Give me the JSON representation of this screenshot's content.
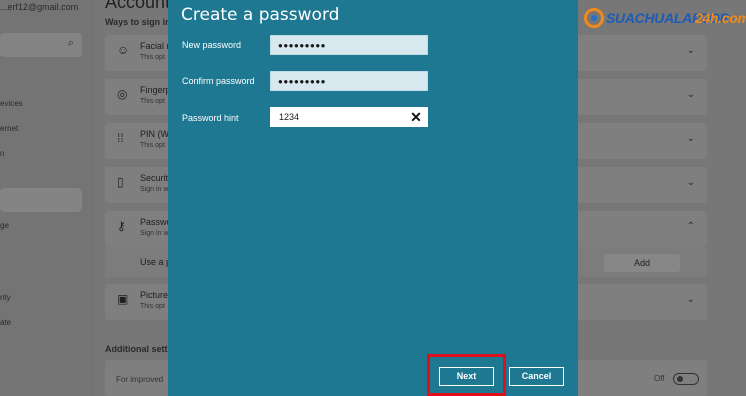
{
  "background": {
    "title": "Accounts",
    "email": "...erf12@gmail.com",
    "nav_items": [
      "evices",
      "ernet",
      "n",
      "ge",
      "rity",
      "ate"
    ],
    "section_ways": "Ways to sign in",
    "section_additional": "Additional settin",
    "cards": [
      {
        "title": "Facial r",
        "subtitle": "This opt",
        "icon": "face-icon"
      },
      {
        "title": "Fingerp",
        "subtitle": "This opt",
        "icon": "fingerprint-icon"
      },
      {
        "title": "PIN (W",
        "subtitle": "This opt",
        "icon": "keypad-icon"
      },
      {
        "title": "Security",
        "subtitle": "Sign in w",
        "icon": "security-key-icon"
      },
      {
        "title": "Passwo",
        "subtitle": "Sign in w",
        "icon": "key-icon"
      },
      {
        "title": "Picture",
        "subtitle": "This opt",
        "icon": "picture-icon"
      }
    ],
    "use_a_row": "Use a p",
    "add_label": "Add",
    "improved_text": "For improved",
    "toggle_state": "Off"
  },
  "logo": {
    "part1": "SUACHUALAPTOP",
    "part2": "24h.com"
  },
  "dialog": {
    "title": "Create a password",
    "new_password_label": "New password",
    "new_password_value": "●●●●●●●●●",
    "confirm_password_label": "Confirm password",
    "confirm_password_value": "●●●●●●●●●",
    "hint_label": "Password hint",
    "hint_value": "1234",
    "clear_glyph": "✕",
    "next_label": "Next",
    "cancel_label": "Cancel"
  },
  "colors": {
    "dialog_bg": "#1e7891",
    "highlight": "#e00f1c",
    "logo_blue": "#1d5bb5",
    "logo_orange": "#f08a1c"
  }
}
